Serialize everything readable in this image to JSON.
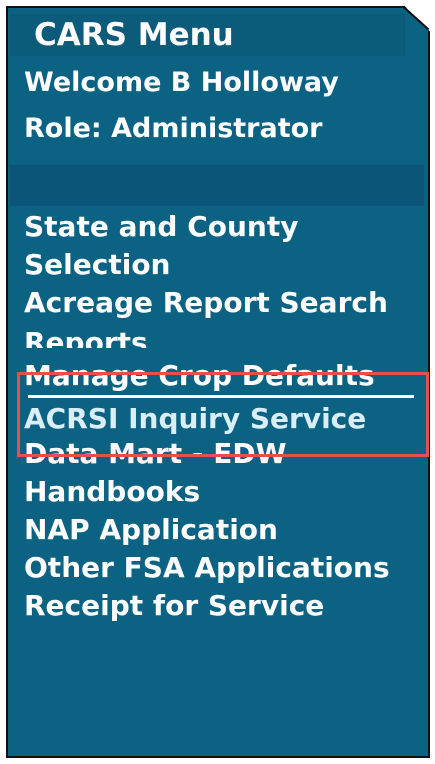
{
  "menu": {
    "title": "CARS Menu",
    "welcome": "Welcome B Holloway",
    "role": "Role: Administrator",
    "items": [
      {
        "label": "State and County Selection"
      },
      {
        "label": "Acreage Report Search"
      },
      {
        "label": "Reports"
      },
      {
        "label": "Manage Crop Defaults",
        "selected": true
      },
      {
        "label": "ACRSI Inquiry Service"
      },
      {
        "label": "Data Mart - EDW"
      },
      {
        "label": "Handbooks"
      },
      {
        "label": "NAP Application"
      },
      {
        "label": "Other FSA Applications"
      },
      {
        "label": "Receipt for Service"
      }
    ]
  },
  "highlight_color": "#e84e4f"
}
